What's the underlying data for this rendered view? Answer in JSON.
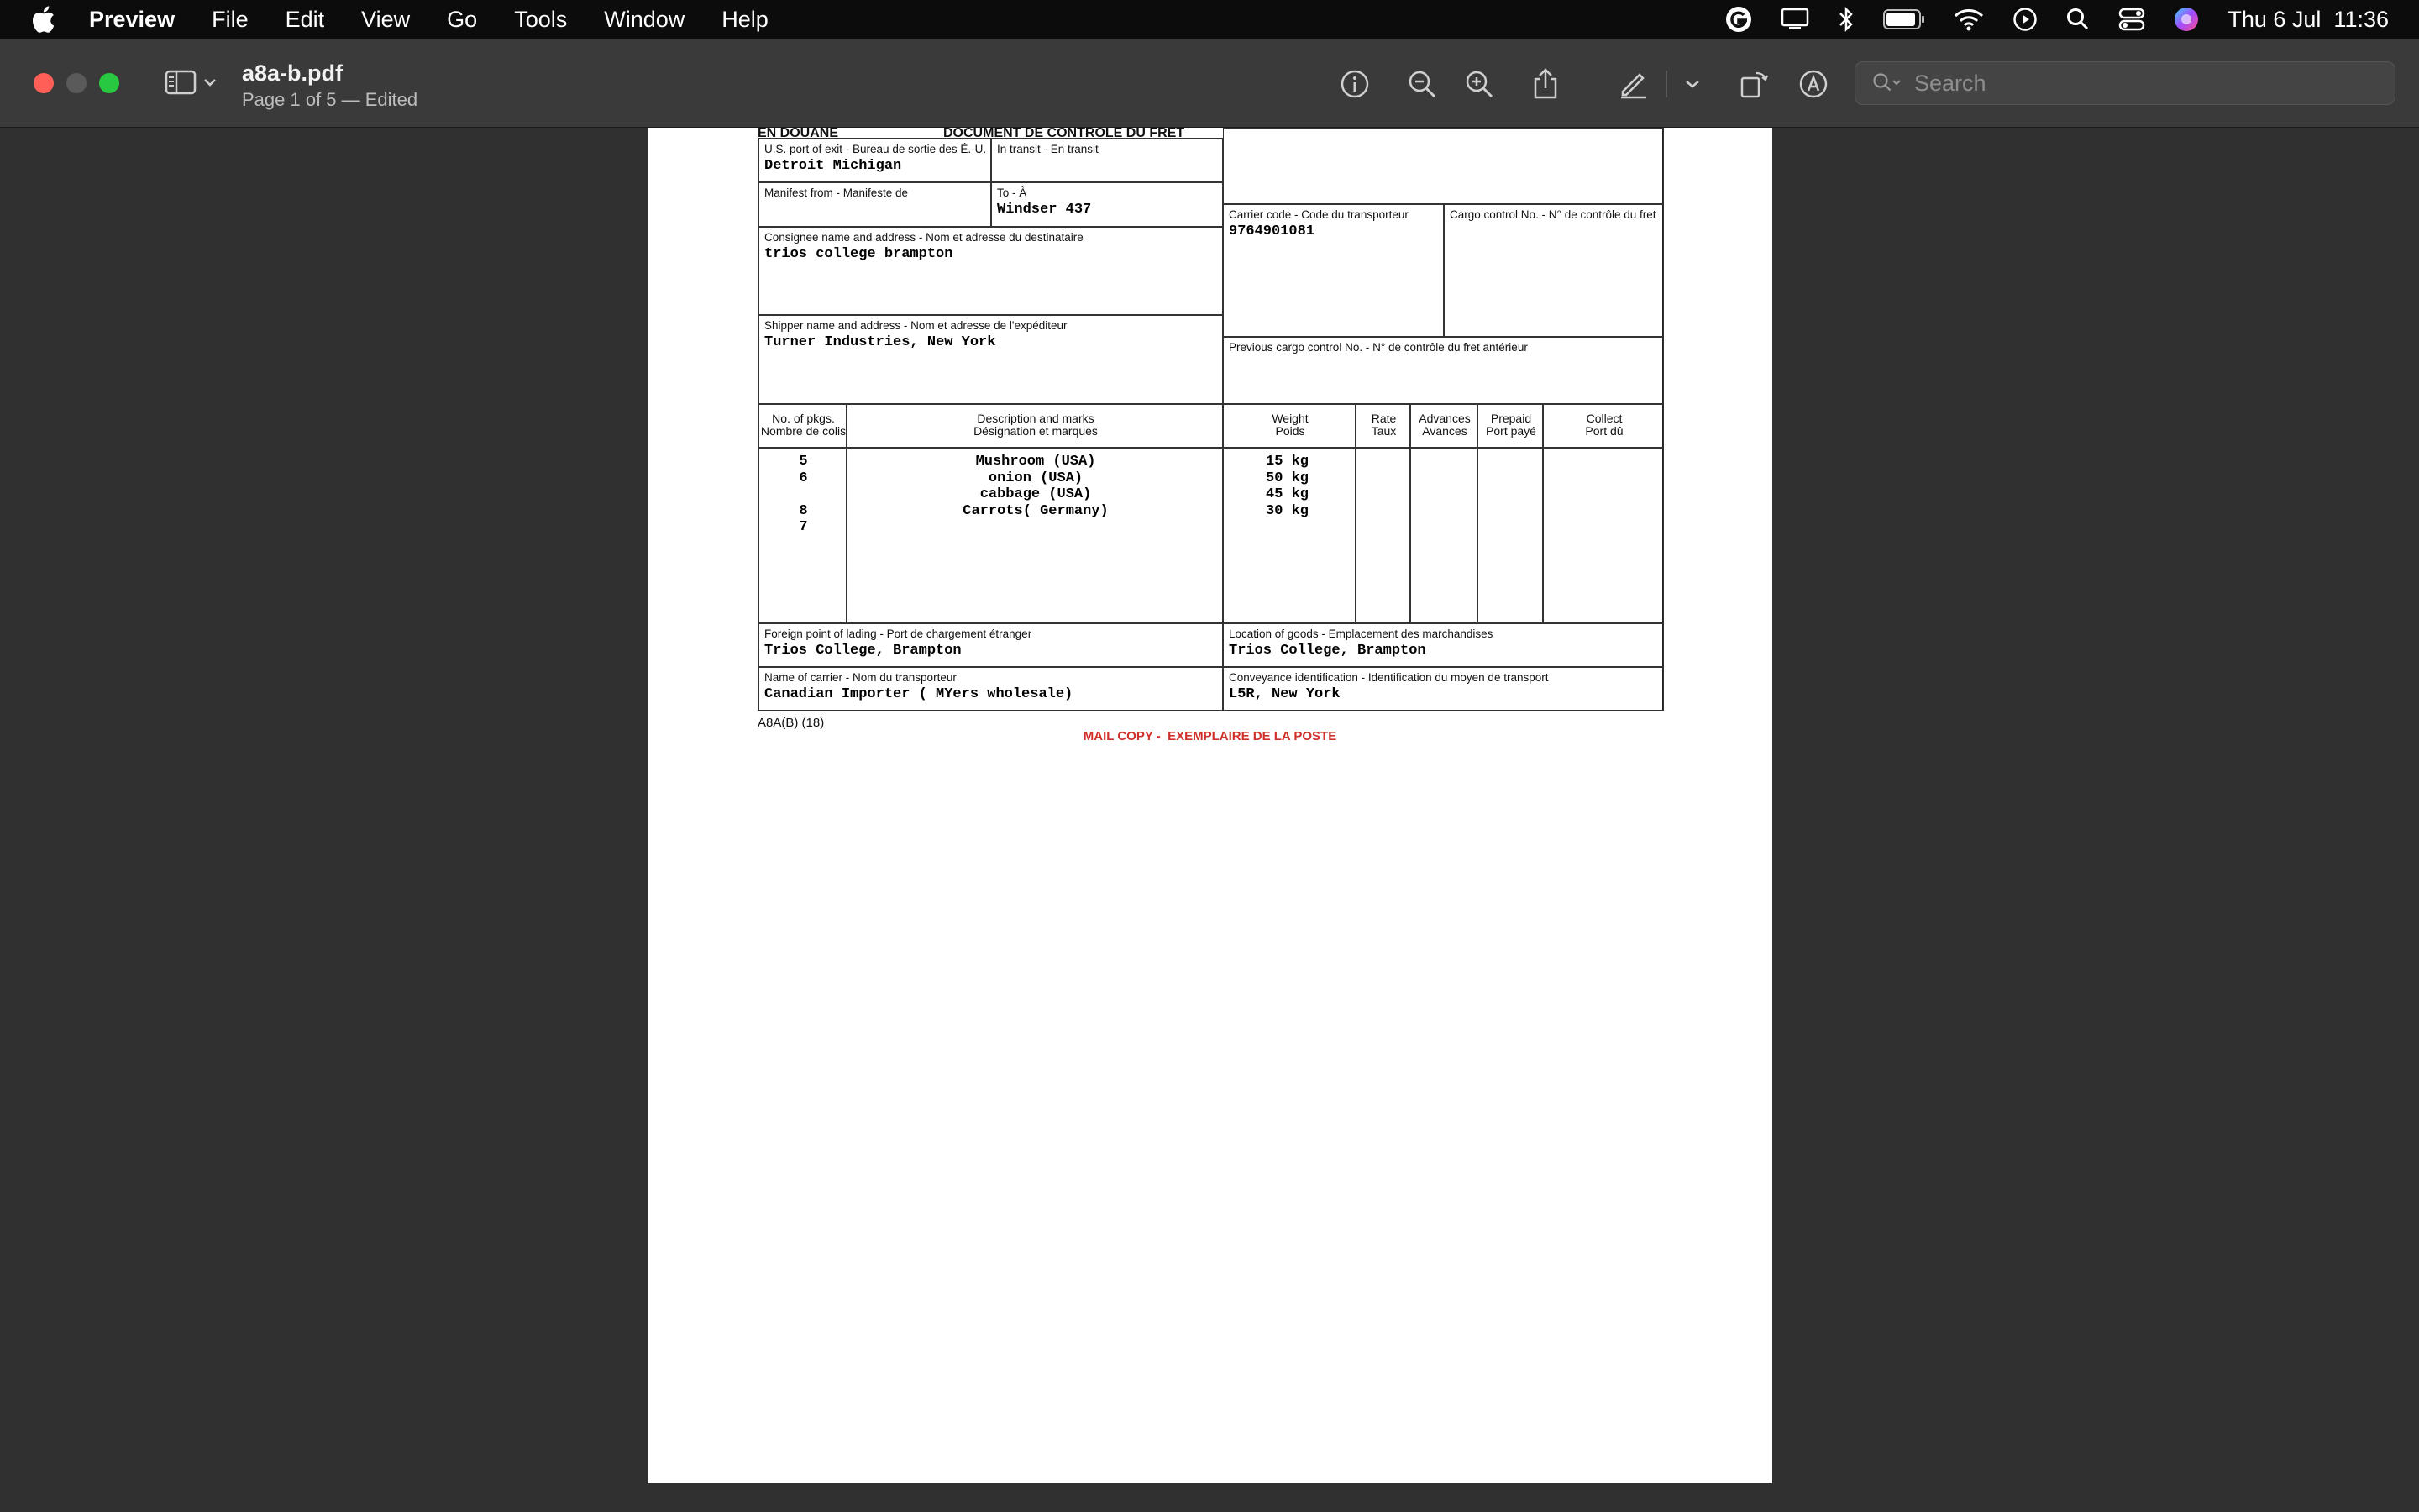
{
  "menubar": {
    "app_name": "Preview",
    "menus": [
      "File",
      "Edit",
      "View",
      "Go",
      "Tools",
      "Window",
      "Help"
    ],
    "clock": "Thu 6 Jul  11:36"
  },
  "toolbar": {
    "doc_title": "a8a-b.pdf",
    "doc_subtitle": "Page 1 of 5 — Edited",
    "search_placeholder": "Search"
  },
  "document": {
    "header_left": "EN DOUANE",
    "header_right": "DOCUMENT DE CONTRÔLE DU FRET",
    "us_port": {
      "label": "U.S. port of exit - Bureau de sortie des É.-U.",
      "value": "Detroit Michigan"
    },
    "in_transit": {
      "label": "In transit - En transit",
      "value": ""
    },
    "manifest_from": {
      "label": "Manifest from - Manifeste de",
      "value": ""
    },
    "to": {
      "label": "To - À",
      "value": "Windser 437"
    },
    "consignee": {
      "label": "Consignee name and address - Nom et adresse du destinataire",
      "value": "trios college brampton"
    },
    "shipper": {
      "label": "Shipper name and address - Nom et adresse de l'expéditeur",
      "value": "Turner Industries, New York"
    },
    "carrier_code": {
      "label": "Carrier code - Code du transporteur",
      "value": "9764901081"
    },
    "cargo_control": {
      "label": "Cargo control No. - N° de contrôle du fret",
      "value": ""
    },
    "prev_cargo": {
      "label": "Previous cargo control No. - N° de contrôle du fret antérieur",
      "value": ""
    },
    "columns": {
      "pkgs": [
        "No. of pkgs.",
        "Nombre de colis"
      ],
      "desc": [
        "Description and marks",
        "Désignation et marques"
      ],
      "weight": [
        "Weight",
        "Poids"
      ],
      "rate": [
        "Rate",
        "Taux"
      ],
      "advances": [
        "Advances",
        "Avances"
      ],
      "prepaid": [
        "Prepaid",
        "Port payé"
      ],
      "collect": [
        "Collect",
        "Port dû"
      ]
    },
    "pkgs": [
      "5",
      "6",
      "",
      "8",
      "7"
    ],
    "descriptions": [
      "Mushroom (USA)",
      "onion (USA)",
      "cabbage (USA)",
      "Carrots( Germany)"
    ],
    "weights": [
      "15 kg",
      "50 kg",
      "45 kg",
      "30 kg"
    ],
    "lading": {
      "label": "Foreign point of lading - Port de chargement étranger",
      "value": "Trios College, Brampton"
    },
    "location": {
      "label": "Location of goods - Emplacement des marchandises",
      "value": "Trios College, Brampton"
    },
    "carrier_name": {
      "label": "Name of carrier - Nom du transporteur",
      "value": "Canadian Importer ( MYers wholesale)"
    },
    "conveyance": {
      "label": "Conveyance identification - Identification du moyen de transport",
      "value": "L5R, New York"
    },
    "form_code": "A8A(B) (18)",
    "mail_copy": "MAIL COPY -  EXEMPLAIRE DE LA POSTE"
  }
}
